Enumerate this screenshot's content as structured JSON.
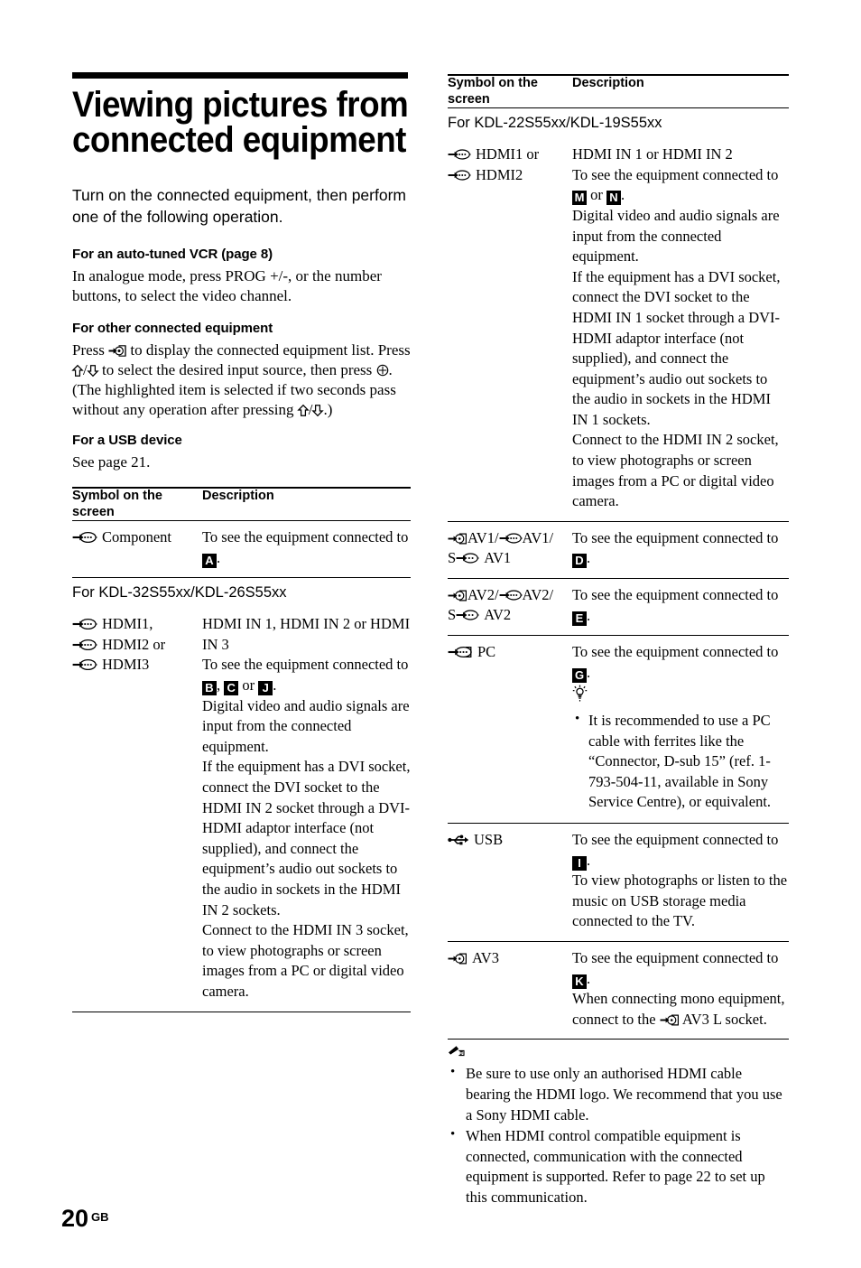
{
  "page": {
    "number": "20",
    "region_code": "GB"
  },
  "heading": {
    "title": "Viewing pictures from connected equipment",
    "lead": "Turn on the connected equipment, then perform one of the following operation."
  },
  "sections": [
    {
      "heading": "For an auto-tuned VCR (page 8)",
      "body": "In analogue mode, press PROG +/-, or the number buttons, to select the video channel."
    },
    {
      "heading": "For other connected equipment",
      "body_parts": [
        "Press ",
        " to display the connected equipment list. Press ",
        "/",
        " to select the desired input source, then press ",
        ". (The highlighted item is selected if two seconds pass without any operation after pressing ",
        "/",
        ".)"
      ]
    },
    {
      "heading": "For a USB device",
      "body": "See page 21."
    }
  ],
  "table_left": {
    "header": {
      "col_symbol": "Symbol on the screen",
      "col_description": "Description"
    },
    "rows": [
      {
        "type": "entry",
        "symbols": [
          {
            "icon": "component-input-icon",
            "label": "Component"
          }
        ],
        "description_lines": [
          "To see the equipment connected to "
        ],
        "badges": [
          "A"
        ],
        "trailing": "."
      },
      {
        "type": "group",
        "label": "For KDL-32S55xx/KDL-26S55xx"
      },
      {
        "type": "entry",
        "symbols": [
          {
            "icon": "hdmi-input-icon",
            "label": "HDMI1,"
          },
          {
            "icon": "hdmi-input-icon",
            "label": "HDMI2 or"
          },
          {
            "icon": "hdmi-input-icon",
            "label": "HDMI3"
          }
        ],
        "description_lines": [
          "HDMI IN 1, HDMI IN 2 or HDMI IN 3",
          "To see the equipment connected to "
        ],
        "badges": [
          "B",
          "C",
          "J"
        ],
        "badge_separators": [
          ", ",
          " or "
        ],
        "trailing": ".",
        "description_after": [
          "Digital video and audio signals are input from the connected equipment.",
          "If the equipment has a DVI socket, connect the DVI socket to the HDMI IN 2 socket through a DVI-HDMI adaptor interface (not supplied), and connect the equipment’s audio out sockets to the audio in sockets in the HDMI IN 2 sockets.",
          "Connect to the HDMI IN 3 socket, to view photographs or screen images from a PC or digital video camera."
        ]
      }
    ]
  },
  "table_right": {
    "header": {
      "col_symbol": "Symbol on the screen",
      "col_description": "Description"
    },
    "rows": [
      {
        "type": "group",
        "label": "For KDL-22S55xx/KDL-19S55xx"
      },
      {
        "type": "entry",
        "symbols": [
          {
            "icon": "hdmi-input-icon",
            "label": "HDMI1 or"
          },
          {
            "icon": "hdmi-input-icon",
            "label": "HDMI2"
          }
        ],
        "description_lines": [
          "HDMI IN 1 or HDMI IN 2",
          "To see the equipment connected to "
        ],
        "badges": [
          "M",
          "N"
        ],
        "badge_separators": [
          " or "
        ],
        "trailing": ".",
        "description_after": [
          "Digital video and audio signals are input from the connected equipment.",
          "If the equipment has a DVI socket, connect the DVI socket to the HDMI IN 1 socket through a DVI-HDMI adaptor interface (not supplied), and connect the equipment’s audio out sockets to the audio in sockets in the HDMI IN 1 sockets.",
          "Connect to the HDMI IN 2 socket, to view photographs or screen images from a PC or digital video camera."
        ]
      },
      {
        "type": "entry",
        "symbols": [
          {
            "icon": "scart-input-icon",
            "label": "AV1/"
          },
          {
            "icon": "composite-input-icon",
            "label": "AV1/"
          },
          {
            "icon": "svideo-input-icon",
            "label": "AV1",
            "prefix": "S"
          }
        ],
        "description_lines": [
          "To see the equipment connected to "
        ],
        "badges": [
          "D"
        ],
        "trailing": "."
      },
      {
        "type": "entry",
        "symbols": [
          {
            "icon": "scart-input-icon",
            "label": "AV2/"
          },
          {
            "icon": "composite-input-icon",
            "label": "AV2/"
          },
          {
            "icon": "svideo-input-icon",
            "label": "AV2",
            "prefix": "S"
          }
        ],
        "description_lines": [
          "To see the equipment connected to "
        ],
        "badges": [
          "E"
        ],
        "trailing": "."
      },
      {
        "type": "entry",
        "symbols": [
          {
            "icon": "pc-input-icon",
            "label": "PC"
          }
        ],
        "description_lines": [
          "To see the equipment connected to "
        ],
        "badges": [
          "G"
        ],
        "trailing": ".",
        "tip": {
          "icon": "tip-lightbulb-icon",
          "items": [
            "It is recommended to use a PC cable with ferrites like the “Connector, D-sub 15” (ref. 1-793-504-11, available in Sony Service Centre), or equivalent."
          ]
        }
      },
      {
        "type": "entry",
        "symbols": [
          {
            "icon": "usb-icon",
            "label": "USB"
          }
        ],
        "description_lines": [
          "To see the equipment connected to "
        ],
        "badges": [
          "I"
        ],
        "trailing": ".",
        "description_after": [
          "To view photographs or listen to the music on USB storage media connected to the TV."
        ]
      },
      {
        "type": "entry",
        "symbols": [
          {
            "icon": "scart-input-icon",
            "label": "AV3"
          }
        ],
        "description_lines": [
          "To see the equipment connected to "
        ],
        "badges": [
          "K"
        ],
        "trailing": ".",
        "description_mono_prefix": "When connecting mono equipment, connect to the ",
        "description_mono_suffix": " AV3 L socket."
      }
    ],
    "notes": {
      "icon": "note-pencil-icon",
      "items": [
        "Be sure to use only an authorised HDMI cable bearing the HDMI logo. We recommend that you use a Sony HDMI cable.",
        "When HDMI control compatible equipment is connected, communication with the connected equipment is supported. Refer to page 22 to set up this communication."
      ]
    }
  }
}
